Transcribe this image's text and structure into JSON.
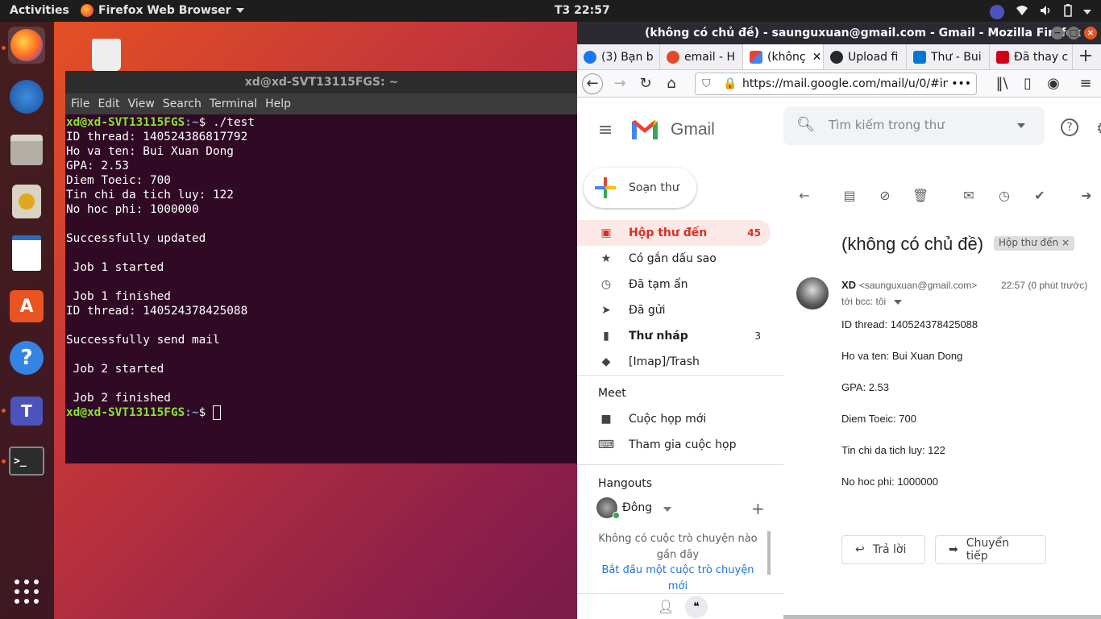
{
  "topbar": {
    "activities": "Activities",
    "app_menu": "Firefox Web Browser",
    "clock": "T3 22:57"
  },
  "terminal": {
    "title": "xd@xd-SVT13115FGS: ~",
    "menu": [
      "File",
      "Edit",
      "View",
      "Search",
      "Terminal",
      "Help"
    ],
    "prompt_user": "xd@xd-SVT13115FGS",
    "prompt_path": ":~",
    "command": "$ ./test",
    "lines": [
      "ID thread: 140524386817792",
      "Ho va ten: Bui Xuan Dong",
      "GPA: 2.53",
      "Diem Toeic: 700",
      "Tin chi da tich luy: 122",
      "No hoc phi: 1000000",
      "",
      "Successfully updated",
      "",
      " Job 1 started",
      "",
      " Job 1 finished",
      "ID thread: 140524378425088",
      "",
      "Successfully send mail",
      "",
      " Job 2 started",
      "",
      " Job 2 finished"
    ],
    "final_prompt_tail": "$ "
  },
  "firefox": {
    "window_title": "(không có chủ đề) - saunguxuan@gmail.com - Gmail - Mozilla Firefox",
    "tabs": [
      {
        "label": "(3) Bạn b",
        "color": "#1877f2"
      },
      {
        "label": "email - H",
        "color": "#e34a2a"
      },
      {
        "label": "(khônç",
        "color": "#ea4335"
      },
      {
        "label": "Upload fi",
        "color": "#24292e"
      },
      {
        "label": "Thư - Bui",
        "color": "#0078d4"
      },
      {
        "label": "Đã thay c",
        "color": "#d0021b"
      }
    ],
    "url": "https://mail.google.com/mail/u/0/#in"
  },
  "gmail": {
    "logo": "Gmail",
    "search_placeholder": "Tìm kiếm trong thư",
    "compose": "Soạn thư",
    "nav": [
      {
        "label": "Hộp thư đến",
        "count": "45",
        "icon": "inbox-icon"
      },
      {
        "label": "Có gắn dấu sao",
        "count": "",
        "icon": "star-icon"
      },
      {
        "label": "Đã tạm ẩn",
        "count": "",
        "icon": "clock-icon"
      },
      {
        "label": "Đã gửi",
        "count": "",
        "icon": "send-icon"
      },
      {
        "label": "Thư nháp",
        "count": "3",
        "icon": "draft-icon"
      },
      {
        "label": "[Imap]/Trash",
        "count": "",
        "icon": "label-icon"
      }
    ],
    "meet_title": "Meet",
    "meet_items": [
      "Cuộc họp mới",
      "Tham gia cuộc họp"
    ],
    "hangouts_title": "Hangouts",
    "hangouts_user": "Đông",
    "hangouts_empty": "Không có cuộc trò chuyện nào gần đây",
    "hangouts_start": "Bắt đầu một cuộc trò chuyện mới",
    "subject": "(không có chủ đề)",
    "label_chip": "Hộp thư đến",
    "sender_name": "XD",
    "sender_email": "<saunguxuan@gmail.com>",
    "time": "22:57 (0 phút trước)",
    "to": "tới bcc: tôi",
    "body": [
      "ID thread: 140524378425088",
      "Ho va ten: Bui Xuan Dong",
      "GPA: 2.53",
      "Diem Toeic: 700",
      "Tin chi da tich luy: 122",
      "No hoc phi: 1000000"
    ],
    "reply": "Trả lời",
    "forward": "Chuyển tiếp"
  },
  "colors": {
    "ubuntu_orange": "#e95420",
    "terminal_bg": "#300a24",
    "gmail_red": "#d93025"
  }
}
